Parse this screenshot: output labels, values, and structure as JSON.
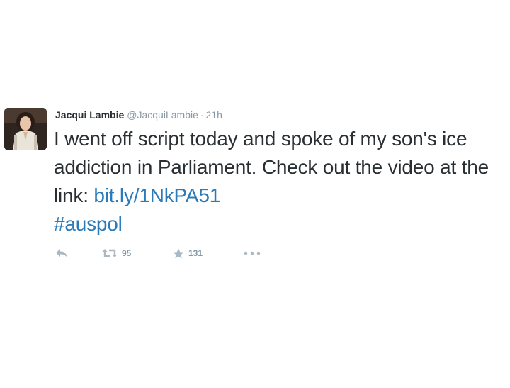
{
  "tweet": {
    "author_name": "Jacqui Lambie",
    "handle": "@JacquiLambie",
    "separator": "·",
    "time": "21h",
    "text_before_link": "I went off script today and spoke of my son's ice addiction in Parliament. Check out the video at the link: ",
    "link": "bit.ly/1NkPA51",
    "hashtag": "#auspol"
  },
  "actions": {
    "reply_icon": "reply-icon",
    "retweet_icon": "retweet-icon",
    "retweet_count": "95",
    "favorite_icon": "star-icon",
    "favorite_count": "131",
    "more_icon": "more-icon"
  },
  "colors": {
    "text": "#292f33",
    "muted": "#8899a6",
    "link": "#2b7bb9",
    "icon": "#aab8c2"
  }
}
